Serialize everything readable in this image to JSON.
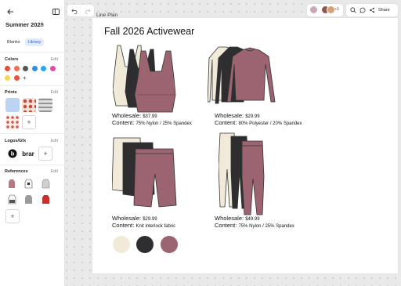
{
  "sidebar": {
    "project_title": "Summer 2025",
    "tabs": [
      {
        "label": "Blanks",
        "active": false
      },
      {
        "label": "Library",
        "active": true
      }
    ],
    "colors_heading": "Colors",
    "prints_heading": "Prints",
    "logos_heading": "Logos/Gfx",
    "references_heading": "References",
    "edit_label": "Edit",
    "logo_texts": [
      "brar"
    ],
    "color_swatches": [
      "#d9553e",
      "#ed6f55",
      "#555555",
      "#2e8fe6",
      "#29a7e8",
      "#d84fa8",
      "#f3d55a",
      "#e0563f"
    ]
  },
  "toolbar": {
    "share_label": "Share",
    "collaborator_count": "+3"
  },
  "canvas": {
    "plan_label": "Line Plan",
    "page_title": "Fall 2026 Activewear",
    "products": [
      {
        "name": "bra",
        "wholesale_label": "Wholesale:",
        "wholesale": "$37.99",
        "content_label": "Content:",
        "content": "75% Nylon / 25% Spandex"
      },
      {
        "name": "long-sleeve",
        "wholesale_label": "Wholesale:",
        "wholesale": "$29.99",
        "content_label": "Content:",
        "content": "80% Polyester / 20% Spandex"
      },
      {
        "name": "bike-short",
        "wholesale_label": "Wholesale:",
        "wholesale": "$29.99",
        "content_label": "Content:",
        "content": "Knit interlock fabric"
      },
      {
        "name": "legging",
        "wholesale_label": "Wholesale:",
        "wholesale": "$49.99",
        "content_label": "Content:",
        "content": "75% Nylon / 25% Spandex"
      }
    ],
    "colorways": [
      "#f1ead9",
      "#2e2e30",
      "#9b6470"
    ]
  }
}
